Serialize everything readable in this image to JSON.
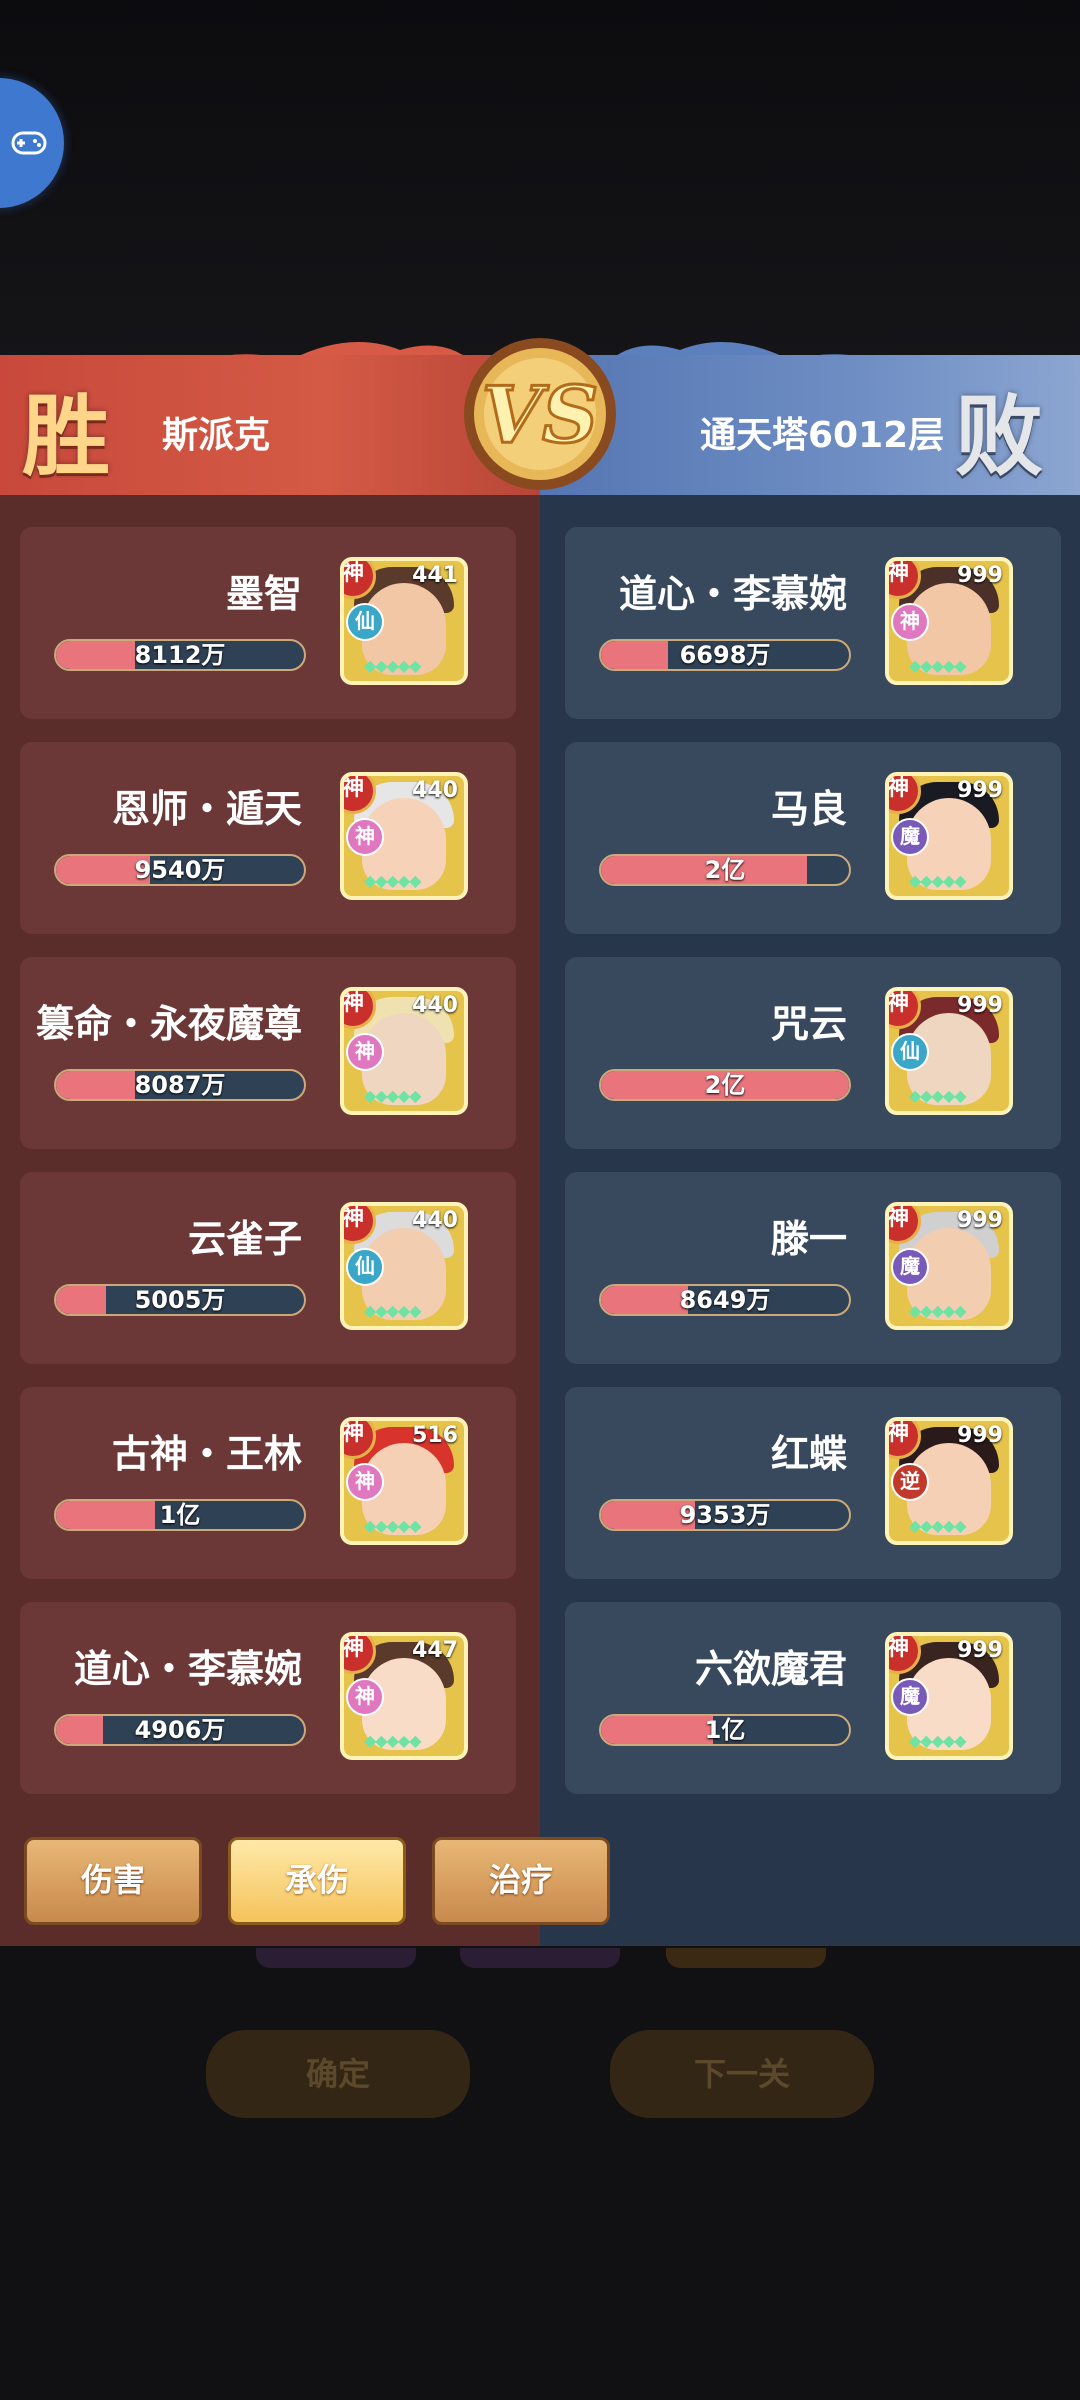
{
  "header": {
    "win_label": "胜",
    "lose_label": "败",
    "left_player": "斯派克",
    "right_player": "通天塔6012层"
  },
  "colors": {
    "win_panel": "#5a2d2b",
    "lose_panel": "#27364a",
    "bar_fill": "#e9747b"
  },
  "left_team": [
    {
      "name": "墨智",
      "value": "8112万",
      "fill": 0.32,
      "level": "441",
      "faction": "仙"
    },
    {
      "name": "恩师・遁天",
      "value": "9540万",
      "fill": 0.38,
      "level": "440",
      "faction": "神脉"
    },
    {
      "name": "篡命・永夜魔尊",
      "value": "8087万",
      "fill": 0.32,
      "level": "440",
      "faction": "神脉"
    },
    {
      "name": "云雀子",
      "value": "5005万",
      "fill": 0.2,
      "level": "440",
      "faction": "仙"
    },
    {
      "name": "古神・王林",
      "value": "1亿",
      "fill": 0.4,
      "level": "516",
      "faction": "神脉"
    },
    {
      "name": "道心・李慕婉",
      "value": "4906万",
      "fill": 0.19,
      "level": "447",
      "faction": "神脉"
    }
  ],
  "right_team": [
    {
      "name": "道心・李慕婉",
      "value": "6698万",
      "fill": 0.27,
      "level": "999",
      "faction": "神脉"
    },
    {
      "name": "马良",
      "value": "2亿",
      "fill": 0.83,
      "level": "999",
      "faction": "魔"
    },
    {
      "name": "咒云",
      "value": "2亿",
      "fill": 1.0,
      "level": "999",
      "faction": "仙"
    },
    {
      "name": "滕一",
      "value": "8649万",
      "fill": 0.35,
      "level": "999",
      "faction": "魔"
    },
    {
      "name": "红蝶",
      "value": "9353万",
      "fill": 0.38,
      "level": "999",
      "faction": "逆"
    },
    {
      "name": "六欲魔君",
      "value": "1亿",
      "fill": 0.45,
      "level": "999",
      "faction": "魔"
    }
  ],
  "god_badge": "神",
  "tabs": {
    "damage": "伤害",
    "taken": "承伤",
    "heal": "治疗"
  },
  "behind_buttons": {
    "confirm": "确定",
    "next": "下一关"
  }
}
